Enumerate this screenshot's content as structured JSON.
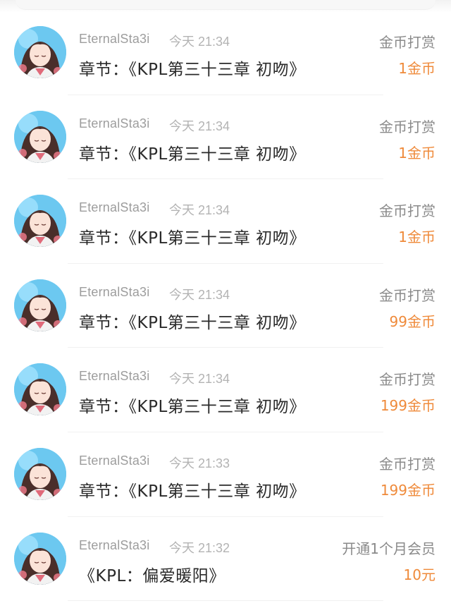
{
  "colors": {
    "amount": "#ef8a3a",
    "username": "#9d9d9d",
    "time": "#b3b3b3",
    "content": "#2a2a2a",
    "type": "#8a8a8a"
  },
  "records": [
    {
      "user": "EternalSta3i",
      "time": "今天 21:34",
      "content": "章节：《KPL第三十三章 初吻》",
      "type": "金币打赏",
      "amount": "1金币"
    },
    {
      "user": "EternalSta3i",
      "time": "今天 21:34",
      "content": "章节：《KPL第三十三章 初吻》",
      "type": "金币打赏",
      "amount": "1金币"
    },
    {
      "user": "EternalSta3i",
      "time": "今天 21:34",
      "content": "章节：《KPL第三十三章 初吻》",
      "type": "金币打赏",
      "amount": "1金币"
    },
    {
      "user": "EternalSta3i",
      "time": "今天 21:34",
      "content": "章节：《KPL第三十三章 初吻》",
      "type": "金币打赏",
      "amount": "99金币"
    },
    {
      "user": "EternalSta3i",
      "time": "今天 21:34",
      "content": "章节：《KPL第三十三章 初吻》",
      "type": "金币打赏",
      "amount": "199金币"
    },
    {
      "user": "EternalSta3i",
      "time": "今天 21:33",
      "content": "章节：《KPL第三十三章 初吻》",
      "type": "金币打赏",
      "amount": "199金币"
    },
    {
      "user": "EternalSta3i",
      "time": "今天 21:32",
      "content": "《KPL：偏爱暖阳》",
      "type": "开通1个月会员",
      "amount": "10元"
    }
  ]
}
